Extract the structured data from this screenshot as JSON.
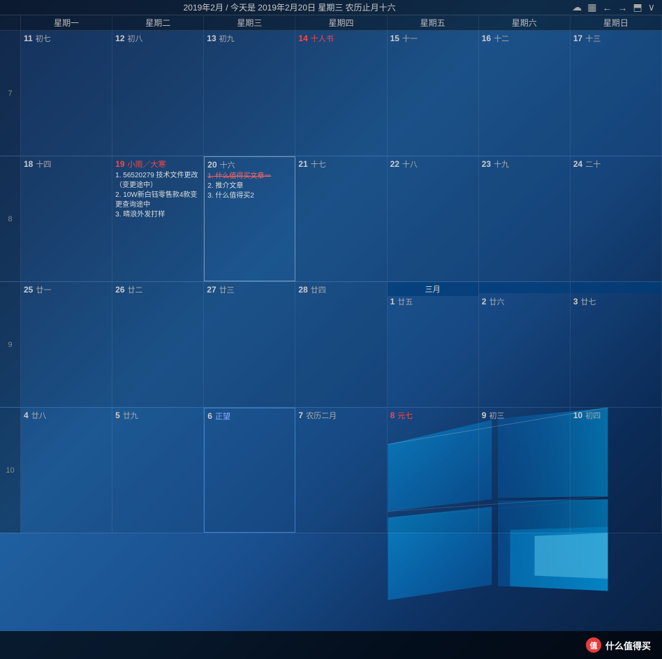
{
  "header": {
    "title": "2019年2月 / 今天是 2019年2月20日 星期三 农历止月十六",
    "icons": {
      "cloud": "☁",
      "calendar": "▦",
      "back": "←",
      "forward": "→",
      "export": "⬒",
      "menu": "∨"
    }
  },
  "weekdays": [
    "星期一",
    "星期二",
    "星期三",
    "星期四",
    "星期五",
    "星期六",
    "星期日"
  ],
  "weeks": [
    {
      "weekNum": "7",
      "days": [
        {
          "day": "11",
          "lunar": "初七",
          "isRed": false,
          "events": []
        },
        {
          "day": "12",
          "lunar": "初八",
          "isRed": false,
          "events": []
        },
        {
          "day": "13",
          "lunar": "初九",
          "isRed": false,
          "events": []
        },
        {
          "day": "14",
          "lunar": "十人书",
          "isRed": true,
          "events": []
        },
        {
          "day": "15",
          "lunar": "十一",
          "isRed": false,
          "events": []
        },
        {
          "day": "16",
          "lunar": "十二",
          "isRed": false,
          "events": []
        },
        {
          "day": "17",
          "lunar": "十三",
          "isRed": false,
          "events": []
        }
      ]
    },
    {
      "weekNum": "8",
      "days": [
        {
          "day": "18",
          "lunar": "十四",
          "isRed": false,
          "events": []
        },
        {
          "day": "19",
          "lunar": "小雨／大寒",
          "isRed": true,
          "events": [
            "1. 56520279 技术文件更改（变更途中）",
            "2. 10W新白钰零售款4款变更查询途中",
            "3. 晴浪外发打样"
          ]
        },
        {
          "day": "20",
          "lunar": "十六",
          "isRed": false,
          "isToday": true,
          "events": [
            "1. 什么值得买文章一",
            "2. 推介文章",
            "3. 什么值得买2"
          ]
        },
        {
          "day": "21",
          "lunar": "十七",
          "isRed": false,
          "events": []
        },
        {
          "day": "22",
          "lunar": "十八",
          "isRed": false,
          "events": []
        },
        {
          "day": "23",
          "lunar": "十九",
          "isRed": false,
          "events": []
        },
        {
          "day": "24",
          "lunar": "二十",
          "isRed": false,
          "events": []
        }
      ]
    },
    {
      "weekNum": "9",
      "days": [
        {
          "day": "25",
          "lunar": "廿一",
          "isRed": false,
          "events": []
        },
        {
          "day": "26",
          "lunar": "廿二",
          "isRed": false,
          "events": []
        },
        {
          "day": "27",
          "lunar": "廿三",
          "isRed": false,
          "events": []
        },
        {
          "day": "28",
          "lunar": "廿四",
          "isRed": false,
          "events": []
        },
        {
          "day": "",
          "lunar": "",
          "isMarch": true,
          "marchLabel": "三月",
          "marchDays": [
            {
              "day": "1",
              "lunar": "廿五",
              "isRed": false
            },
            {
              "day": "2",
              "lunar": "廿六",
              "isRed": false
            },
            {
              "day": "3",
              "lunar": "廿七",
              "isRed": false
            }
          ]
        },
        {
          "day": "",
          "lunar": "",
          "isMarchCell": true,
          "marchIdx": 1
        },
        {
          "day": "",
          "lunar": "",
          "isMarchCell": true,
          "marchIdx": 2
        }
      ]
    },
    {
      "weekNum": "10",
      "days": [
        {
          "day": "4",
          "lunar": "廿八",
          "isRed": false,
          "events": []
        },
        {
          "day": "5",
          "lunar": "廿九",
          "isRed": false,
          "events": []
        },
        {
          "day": "6",
          "lunar": "正望",
          "isRed": false,
          "isSpecial": true,
          "events": []
        },
        {
          "day": "7",
          "lunar": "农历二月",
          "isRed": false,
          "events": []
        },
        {
          "day": "8",
          "lunar": "元七",
          "isRed": true,
          "events": []
        },
        {
          "day": "9",
          "lunar": "初三",
          "isRed": false,
          "events": []
        },
        {
          "day": "10",
          "lunar": "初四",
          "isRed": false,
          "events": []
        }
      ]
    }
  ],
  "bottomBrand": {
    "text": "什么值得买",
    "iconText": "值"
  }
}
